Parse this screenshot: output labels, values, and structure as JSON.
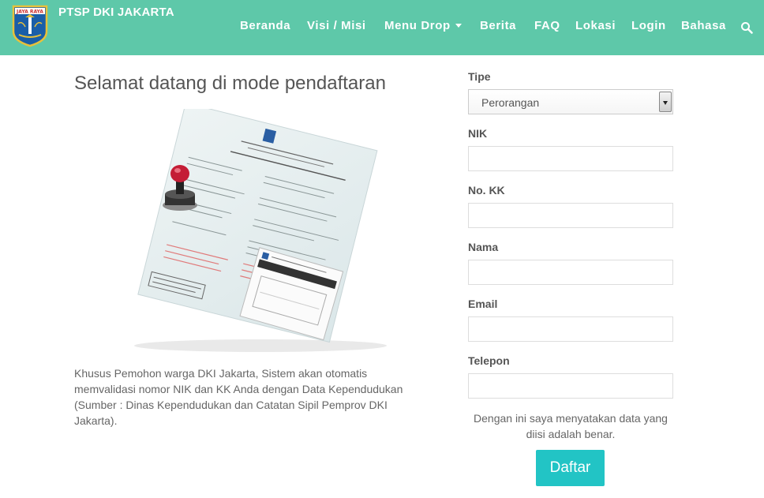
{
  "header": {
    "brand": "PTSP DKI JAKARTA",
    "nav": [
      {
        "label": "Beranda"
      },
      {
        "label": "Visi / Misi"
      },
      {
        "label": "Menu Drop"
      },
      {
        "label": "Berita"
      },
      {
        "label": "FAQ"
      },
      {
        "label": "Lokasi"
      },
      {
        "label": "Login"
      },
      {
        "label": "Bahasa"
      }
    ],
    "logo_text": "JAYA RAYA"
  },
  "main": {
    "title": "Selamat datang di mode pendaftaran",
    "intro": "Khusus Pemohon warga DKI Jakarta, Sistem akan otomatis memvalidasi nomor NIK dan KK Anda dengan Data Kependudukan (Sumber : Dinas Kependudukan dan Catatan Sipil Pemprov DKI Jakarta)."
  },
  "form": {
    "type_label": "Tipe",
    "type_value": "Perorangan",
    "nik_label": "NIK",
    "kk_label": "No. KK",
    "name_label": "Nama",
    "email_label": "Email",
    "phone_label": "Telepon",
    "nik_value": "",
    "kk_value": "",
    "name_value": "",
    "email_value": "",
    "phone_value": "",
    "disclaimer": "Dengan ini saya menyatakan data yang diisi adalah benar.",
    "submit": "Daftar"
  },
  "colors": {
    "navbar": "#5ec8a9",
    "button": "#22c4c5"
  }
}
